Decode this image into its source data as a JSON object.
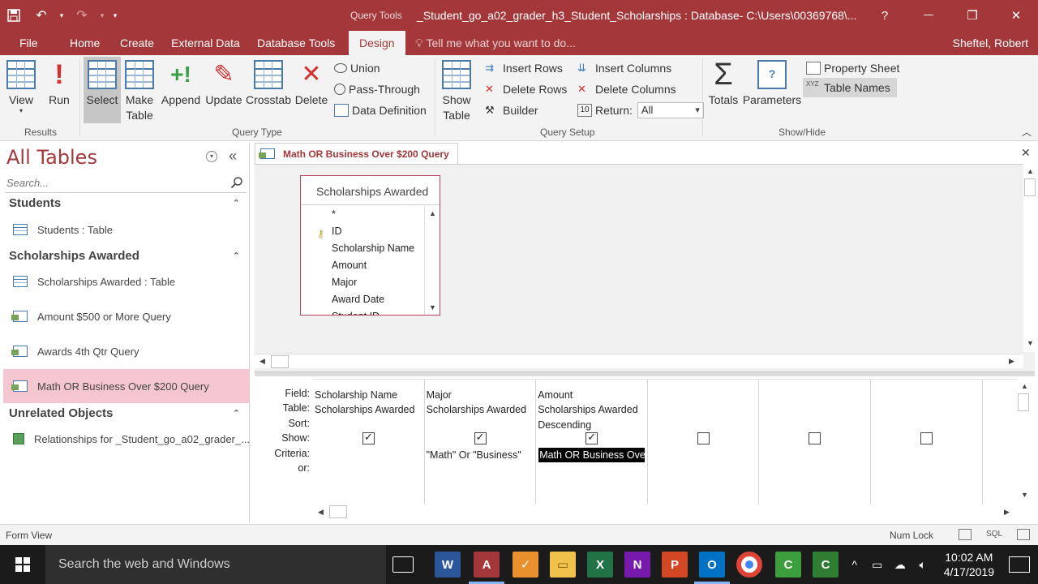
{
  "titlebar": {
    "context_tab": "Query Tools",
    "title": "_Student_go_a02_grader_h3_Student_Scholarships : Database- C:\\Users\\00369768\\...",
    "help": "?",
    "restore": "❐",
    "close": "✕"
  },
  "tabs": [
    "File",
    "Home",
    "Create",
    "External Data",
    "Database Tools",
    "Design"
  ],
  "active_tab": "Design",
  "tell_me": "Tell me what you want to do...",
  "user": "Sheftel, Robert",
  "ribbon": {
    "results": {
      "label": "Results",
      "view": "View",
      "run": "Run"
    },
    "query_type": {
      "label": "Query Type",
      "select": "Select",
      "make_table_1": "Make",
      "make_table_2": "Table",
      "append": "Append",
      "update": "Update",
      "crosstab": "Crosstab",
      "delete": "Delete",
      "union": "Union",
      "pass_through": "Pass-Through",
      "data_definition": "Data Definition"
    },
    "query_setup": {
      "label": "Query Setup",
      "show_table_1": "Show",
      "show_table_2": "Table",
      "insert_rows": "Insert Rows",
      "delete_rows": "Delete Rows",
      "builder": "Builder",
      "insert_columns": "Insert Columns",
      "delete_columns": "Delete Columns",
      "return_label": "Return:",
      "return_value": "All"
    },
    "show_hide": {
      "label": "Show/Hide",
      "totals": "Totals",
      "parameters": "Parameters",
      "property_sheet": "Property Sheet",
      "table_names": "Table Names"
    }
  },
  "nav": {
    "title": "All Tables",
    "search_placeholder": "Search...",
    "groups": [
      {
        "name": "Students",
        "items": [
          "Students : Table"
        ]
      },
      {
        "name": "Scholarships Awarded",
        "items": [
          "Scholarships Awarded : Table",
          "Amount $500 or More Query",
          "Awards 4th Qtr Query",
          "Math OR Business Over $200 Query"
        ]
      },
      {
        "name": "Unrelated Objects",
        "items": [
          "Relationships for _Student_go_a02_grader_..."
        ]
      }
    ]
  },
  "document": {
    "tab_title": "Math OR Business Over $200 Query",
    "table_box": {
      "title": "Scholarships Awarded",
      "fields": [
        "*",
        "ID",
        "Scholarship Name",
        "Amount",
        "Major",
        "Award Date",
        "Student ID"
      ]
    },
    "row_labels": [
      "Field:",
      "Table:",
      "Sort:",
      "Show:",
      "Criteria:",
      "or:"
    ],
    "columns": [
      {
        "field": "Scholarship Name",
        "table": "Scholarships Awarded",
        "sort": "",
        "show": true,
        "criteria": ""
      },
      {
        "field": "Major",
        "table": "Scholarships Awarded",
        "sort": "",
        "show": true,
        "criteria": "\"Math\" Or \"Business\""
      },
      {
        "field": "Amount",
        "table": "Scholarships Awarded",
        "sort": "Descending",
        "show": true,
        "criteria": "Math OR Business Over"
      },
      {
        "field": "",
        "table": "",
        "sort": "",
        "show": false,
        "criteria": ""
      },
      {
        "field": "",
        "table": "",
        "sort": "",
        "show": false,
        "criteria": ""
      },
      {
        "field": "",
        "table": "",
        "sort": "",
        "show": false,
        "criteria": ""
      }
    ]
  },
  "status": {
    "left": "Form View",
    "num_lock": "Num Lock",
    "sql": "SQL"
  },
  "taskbar": {
    "search": "Search the web and Windows",
    "time": "10:02 AM",
    "date": "4/17/2019",
    "apps": [
      "task-view",
      "word",
      "access",
      "todo",
      "file-explorer",
      "excel",
      "onenote",
      "powerpoint",
      "outlook",
      "chrome",
      "camtasia",
      "camtasia-recorder"
    ]
  },
  "colors": {
    "accent": "#a4373a",
    "nav_active": "#f4c6cf",
    "taskbar": "#1b1b1b"
  }
}
